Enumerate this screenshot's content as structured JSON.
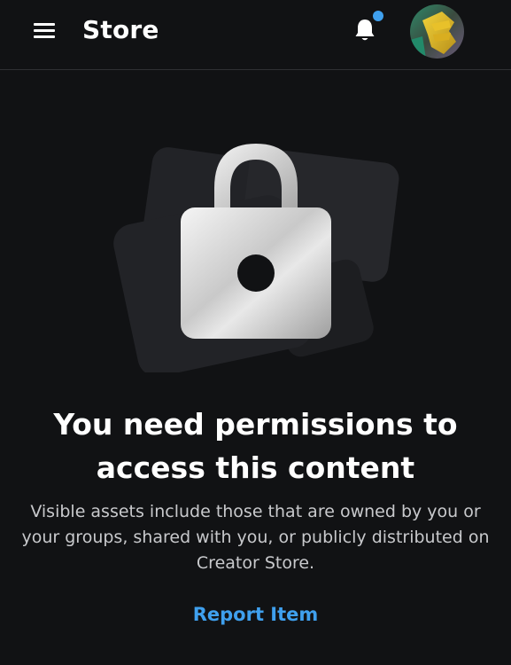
{
  "header": {
    "menu_icon": "hamburger-menu-icon",
    "title": "Store",
    "notification_icon": "bell-icon",
    "has_unread_notifications": true,
    "avatar_icon": "user-avatar"
  },
  "main": {
    "illustration_icon": "padlock-icon",
    "headline_line1": "You need permissions to",
    "headline_line2": "access this content",
    "description_line1": "Visible assets include those that are owned by you or",
    "description_line2": "your groups, shared with you, or publicly distributed on",
    "description_line3": "Creator Store.",
    "report_link_label": "Report Item"
  },
  "colors": {
    "background": "#111214",
    "header_border": "#2f3033",
    "text_primary": "#ffffff",
    "text_secondary": "#c8c9cc",
    "link": "#3fa0ee",
    "notification_dot": "#3fa0ee"
  }
}
